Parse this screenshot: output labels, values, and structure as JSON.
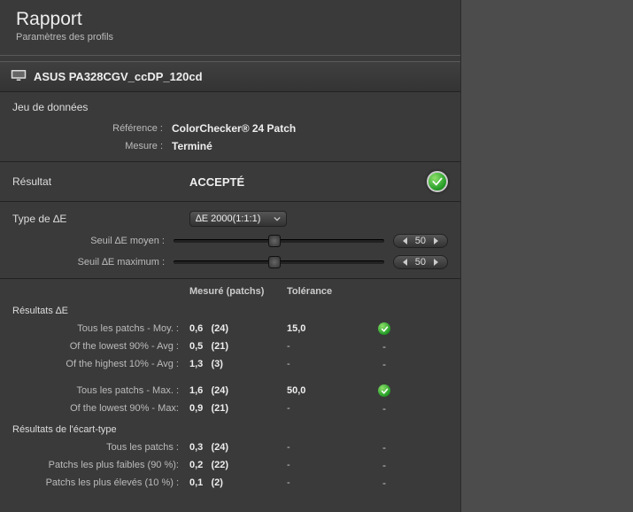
{
  "header": {
    "title": "Rapport",
    "subtitle": "Paramètres des profils"
  },
  "profile": {
    "name": "ASUS PA328CGV_ccDP_120cd"
  },
  "dataset": {
    "heading": "Jeu de données",
    "reference_label": "Référence :",
    "reference_value": "ColorChecker® 24 Patch",
    "measure_label": "Mesure :",
    "measure_value": "Terminé"
  },
  "result": {
    "label": "Résultat",
    "value": "ACCEPTÉ"
  },
  "deltaE": {
    "type_label": "Type de ∆E",
    "type_value": "∆E 2000(1:1:1)",
    "avg_label": "Seuil ∆E moyen :",
    "avg_value": "50",
    "max_label": "Seuil ∆E maximum :",
    "max_value": "50"
  },
  "table": {
    "col_measured": "Mesuré (patchs)",
    "col_tolerance": "Tolérance",
    "group1": "Résultats ∆E",
    "group2": "Résultats de l'écart-type",
    "rows_g1a": [
      {
        "label": "Tous les patchs - Moy. :",
        "m": "0,6   (24)",
        "t": "15,0",
        "pass": true
      },
      {
        "label": "Of the lowest 90% - Avg :",
        "m": "0,5   (21)",
        "t": "-",
        "pass": ""
      },
      {
        "label": "Of the highest 10% - Avg :",
        "m": "1,3   (3)",
        "t": "-",
        "pass": ""
      }
    ],
    "rows_g1b": [
      {
        "label": "Tous les patchs - Max. :",
        "m": "1,6   (24)",
        "t": "50,0",
        "pass": true
      },
      {
        "label": "Of the lowest 90% - Max:",
        "m": "0,9   (21)",
        "t": "-",
        "pass": ""
      }
    ],
    "rows_g2": [
      {
        "label": "Tous les patchs :",
        "m": "0,3   (24)",
        "t": "-",
        "pass": ""
      },
      {
        "label": "Patchs les plus faibles (90 %):",
        "m": "0,2   (22)",
        "t": "-",
        "pass": ""
      },
      {
        "label": "Patchs les plus élevés (10 %) :",
        "m": "0,1   (2)",
        "t": "-",
        "pass": ""
      }
    ]
  }
}
